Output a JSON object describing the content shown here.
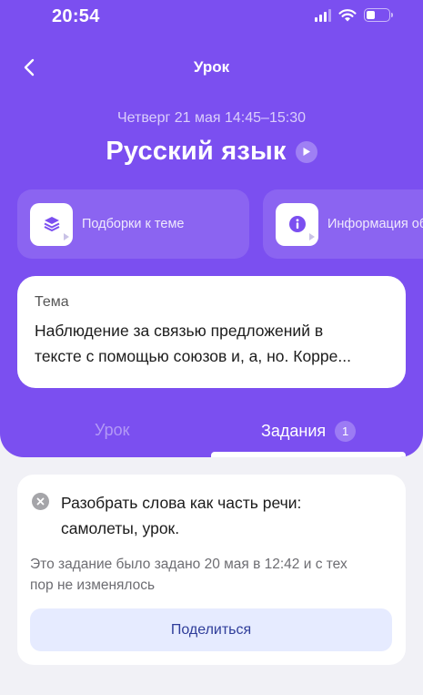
{
  "status_bar": {
    "time": "20:54",
    "battery_level": 0.4
  },
  "nav": {
    "title": "Урок"
  },
  "lesson": {
    "datetime": "Четверг 21 мая  14:45–15:30",
    "subject": "Русский язык"
  },
  "quick_actions": [
    {
      "label": "Подборки к теме",
      "icon": "layers-icon"
    },
    {
      "label": "Информация об уроке",
      "icon": "info-icon"
    }
  ],
  "theme": {
    "label": "Тема",
    "text_line1": "Наблюдение за связью предложений в",
    "text_line2": "тексте с помощью союзов и, а, но. Корре..."
  },
  "tabs": {
    "lesson_label": "Урок",
    "tasks_label": "Задания",
    "tasks_count": "1"
  },
  "task": {
    "title_line1": "Разобрать слова как часть речи:",
    "title_line2": "самолеты, урок.",
    "note_line1": "Это задание было задано 20 мая в 12:42 и с тех",
    "note_line2": "пор не изменялось",
    "share_label": "Поделиться"
  },
  "colors": {
    "accent": "#7b4ff0",
    "share_button_bg": "#e6ebff",
    "share_button_text": "#2f3d9a"
  }
}
